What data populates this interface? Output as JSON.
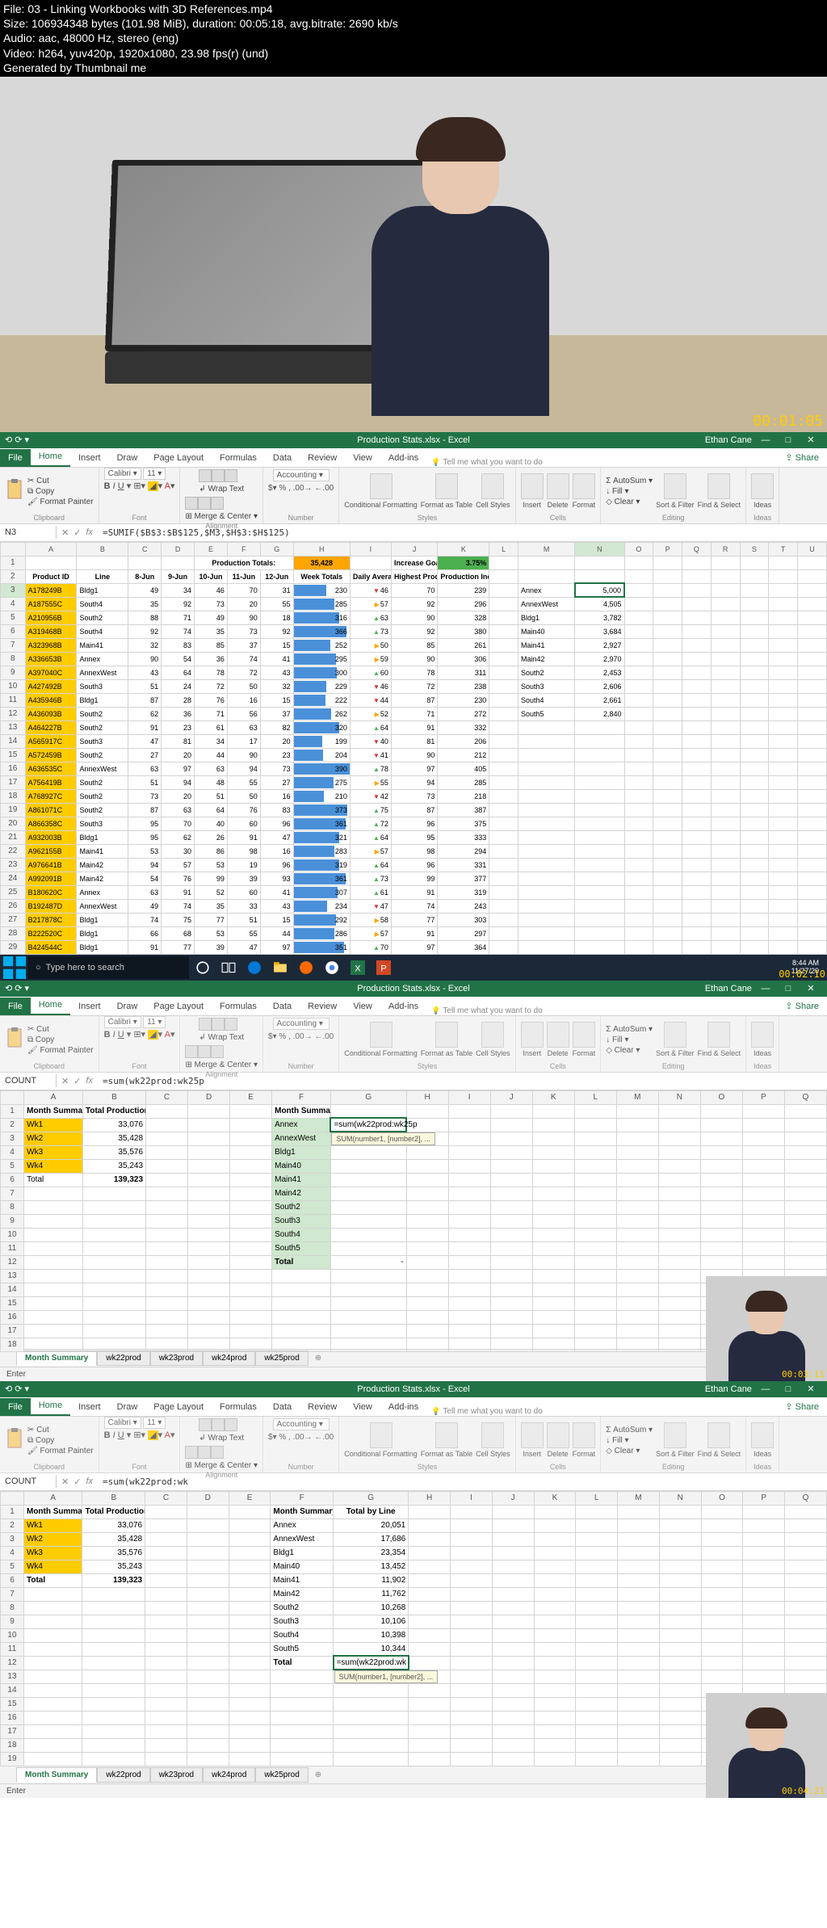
{
  "metadata": {
    "file": "File: 03 - Linking Workbooks with 3D References.mp4",
    "size": "Size: 106934348 bytes (101.98 MiB), duration: 00:05:18, avg.bitrate: 2690 kb/s",
    "audio": "Audio: aac, 48000 Hz, stereo (eng)",
    "video": "Video: h264, yuv420p, 1920x1080, 23.98 fps(r) (und)",
    "generated": "Generated by Thumbnail me"
  },
  "timestamps": {
    "t1": "00:01:05",
    "t2": "00:02:10",
    "t3": "00:03:11",
    "t4": "00:04:21"
  },
  "excel_title": {
    "doc": "Production Stats.xlsx - Excel",
    "user": "Ethan Cane"
  },
  "ribbon_tabs": [
    "File",
    "Home",
    "Insert",
    "Draw",
    "Page Layout",
    "Formulas",
    "Data",
    "Review",
    "View",
    "Add-ins"
  ],
  "tell_me": "Tell me what you want to do",
  "share": "Share",
  "ribbon_groups": {
    "clipboard": "Clipboard",
    "cut": "Cut",
    "copy": "Copy",
    "fp": "Format Painter",
    "font": "Font",
    "alignment": "Alignment",
    "wrap": "Wrap Text",
    "merge": "Merge & Center",
    "number": "Number",
    "accounting": "Accounting",
    "styles": "Styles",
    "cf": "Conditional Formatting",
    "fat": "Format as Table",
    "cs": "Cell Styles",
    "cells": "Cells",
    "ins": "Insert",
    "del": "Delete",
    "fmt": "Format",
    "editing": "Editing",
    "autosum": "AutoSum",
    "fill": "Fill",
    "clear": "Clear",
    "sortf": "Sort & Filter",
    "finds": "Find & Select",
    "ideas": "Ideas"
  },
  "panel1": {
    "namebox": "N3",
    "formula": "=SUMIF($B$3:$B$125,$M3,$H$3:$H$125)",
    "prod_totals_lbl": "Production Totals:",
    "prod_totals_val": "35,428",
    "inc_goal_lbl": "Increase Goal:",
    "inc_goal_val": "3.75%",
    "cols1": [
      "Product ID",
      "Line",
      "8-Jun",
      "9-Jun",
      "10-Jun",
      "11-Jun",
      "12-Jun",
      "Week Totals",
      "Daily Average",
      "Highest Production",
      "Production Increase Goal"
    ],
    "rows": [
      [
        "A178249B",
        "Bldg1",
        49,
        34,
        46,
        70,
        31,
        230,
        46,
        70,
        239
      ],
      [
        "A187555C",
        "South4",
        35,
        92,
        73,
        20,
        55,
        285,
        57,
        92,
        296
      ],
      [
        "A210956B",
        "South2",
        88,
        71,
        49,
        90,
        18,
        316,
        63,
        90,
        328
      ],
      [
        "A319468B",
        "South4",
        92,
        74,
        35,
        73,
        92,
        366,
        73,
        92,
        380
      ],
      [
        "A323968B",
        "Main41",
        32,
        83,
        85,
        37,
        15,
        252,
        50,
        85,
        261
      ],
      [
        "A336653B",
        "Annex",
        90,
        54,
        36,
        74,
        41,
        295,
        59,
        90,
        306
      ],
      [
        "A397040C",
        "AnnexWest",
        43,
        64,
        78,
        72,
        43,
        300,
        60,
        78,
        311
      ],
      [
        "A427492B",
        "South3",
        51,
        24,
        72,
        50,
        32,
        229,
        46,
        72,
        238
      ],
      [
        "A435946B",
        "Bldg1",
        87,
        28,
        76,
        16,
        15,
        222,
        44,
        87,
        230
      ],
      [
        "A436093B",
        "South2",
        62,
        36,
        71,
        56,
        37,
        262,
        52,
        71,
        272
      ],
      [
        "A464227B",
        "South2",
        91,
        23,
        61,
        63,
        82,
        320,
        64,
        91,
        332
      ],
      [
        "A565917C",
        "South3",
        47,
        81,
        34,
        17,
        20,
        199,
        40,
        81,
        206
      ],
      [
        "A572459B",
        "South2",
        27,
        20,
        44,
        90,
        23,
        204,
        41,
        90,
        212
      ],
      [
        "A636535C",
        "AnnexWest",
        63,
        97,
        63,
        94,
        73,
        390,
        78,
        97,
        405
      ],
      [
        "A756419B",
        "South2",
        51,
        94,
        48,
        55,
        27,
        275,
        55,
        94,
        285
      ],
      [
        "A768927C",
        "South2",
        73,
        20,
        51,
        50,
        16,
        210,
        42,
        73,
        218
      ],
      [
        "A861071C",
        "South2",
        87,
        63,
        64,
        76,
        83,
        373,
        75,
        87,
        387
      ],
      [
        "A866358C",
        "South3",
        95,
        70,
        40,
        60,
        96,
        361,
        72,
        96,
        375
      ],
      [
        "A932003B",
        "Bldg1",
        95,
        62,
        26,
        91,
        47,
        321,
        64,
        95,
        333
      ],
      [
        "A962155B",
        "Main41",
        53,
        30,
        86,
        98,
        16,
        283,
        57,
        98,
        294
      ],
      [
        "A976641B",
        "Main42",
        94,
        57,
        53,
        19,
        96,
        319,
        64,
        96,
        331
      ],
      [
        "A992091B",
        "Main42",
        54,
        76,
        99,
        39,
        93,
        361,
        73,
        99,
        377
      ],
      [
        "B180620C",
        "Annex",
        63,
        91,
        52,
        60,
        41,
        307,
        61,
        91,
        319
      ],
      [
        "B192487D",
        "AnnexWest",
        49,
        74,
        35,
        33,
        43,
        234,
        47,
        74,
        243
      ],
      [
        "B217878C",
        "Bldg1",
        74,
        75,
        77,
        51,
        15,
        292,
        58,
        77,
        303
      ],
      [
        "B222520C",
        "Bldg1",
        66,
        68,
        53,
        55,
        44,
        286,
        57,
        91,
        297
      ],
      [
        "B424544C",
        "Bldg1",
        91,
        77,
        39,
        47,
        97,
        351,
        70,
        97,
        364
      ]
    ],
    "side": [
      [
        "Annex",
        "5,000"
      ],
      [
        "AnnexWest",
        "4,505"
      ],
      [
        "Bldg1",
        "3,782"
      ],
      [
        "Main40",
        "3,684"
      ],
      [
        "Main41",
        "2,927"
      ],
      [
        "Main42",
        "2,970"
      ],
      [
        "South2",
        "2,453"
      ],
      [
        "South3",
        "2,606"
      ],
      [
        "South4",
        "2,661"
      ],
      [
        "South5",
        "2,840"
      ]
    ],
    "taskbar": {
      "search": "Type here to search",
      "time": "8:44 AM",
      "date": "11/27/20"
    }
  },
  "panel2": {
    "namebox": "COUNT",
    "formula": "=sum(wk22prod:wk25p",
    "colA_hdr": "Month Summary",
    "colB_hdr": "Total Production",
    "rowsAB": [
      [
        "Wk1",
        "33,076"
      ],
      [
        "Wk2",
        "35,428"
      ],
      [
        "Wk3",
        "35,576"
      ],
      [
        "Wk4",
        "35,243"
      ],
      [
        "Total",
        "139,323"
      ]
    ],
    "colF_hdr": "Month Summary",
    "colG_editing": "=sum(wk22prod:wk25p",
    "tooltip": "SUM(number1, [number2], ...",
    "rowsF": [
      "Annex",
      "AnnexWest",
      "Bldg1",
      "Main40",
      "Main41",
      "Main42",
      "South2",
      "South3",
      "South4",
      "South5",
      "Total"
    ],
    "last_val": "-"
  },
  "panel3": {
    "namebox": "COUNT",
    "formula": "=sum(wk22prod:wk",
    "colA_hdr": "Month Summary",
    "colB_hdr": "Total Production",
    "rowsAB": [
      [
        "Wk1",
        "33,076"
      ],
      [
        "Wk2",
        "35,428"
      ],
      [
        "Wk3",
        "35,576"
      ],
      [
        "Wk4",
        "35,243"
      ],
      [
        "Total",
        "139,323"
      ]
    ],
    "colF_hdr": "Month Summary",
    "colG_hdr": "Total by Line",
    "rowsFG": [
      [
        "Annex",
        "20,051"
      ],
      [
        "AnnexWest",
        "17,686"
      ],
      [
        "Bldg1",
        "23,354"
      ],
      [
        "Main40",
        "13,452"
      ],
      [
        "Main41",
        "11,902"
      ],
      [
        "Main42",
        "11,762"
      ],
      [
        "South2",
        "10,268"
      ],
      [
        "South3",
        "10,106"
      ],
      [
        "South4",
        "10,398"
      ],
      [
        "South5",
        "10,344"
      ]
    ],
    "total_row": "Total",
    "total_editing": "=sum(wk22prod:wk",
    "tooltip": "SUM(number1, [number2], ...",
    "status": "Enter"
  },
  "sheet_tabs": [
    "Month Summary",
    "wk22prod",
    "wk23prod",
    "wk24prod",
    "wk25prod"
  ]
}
